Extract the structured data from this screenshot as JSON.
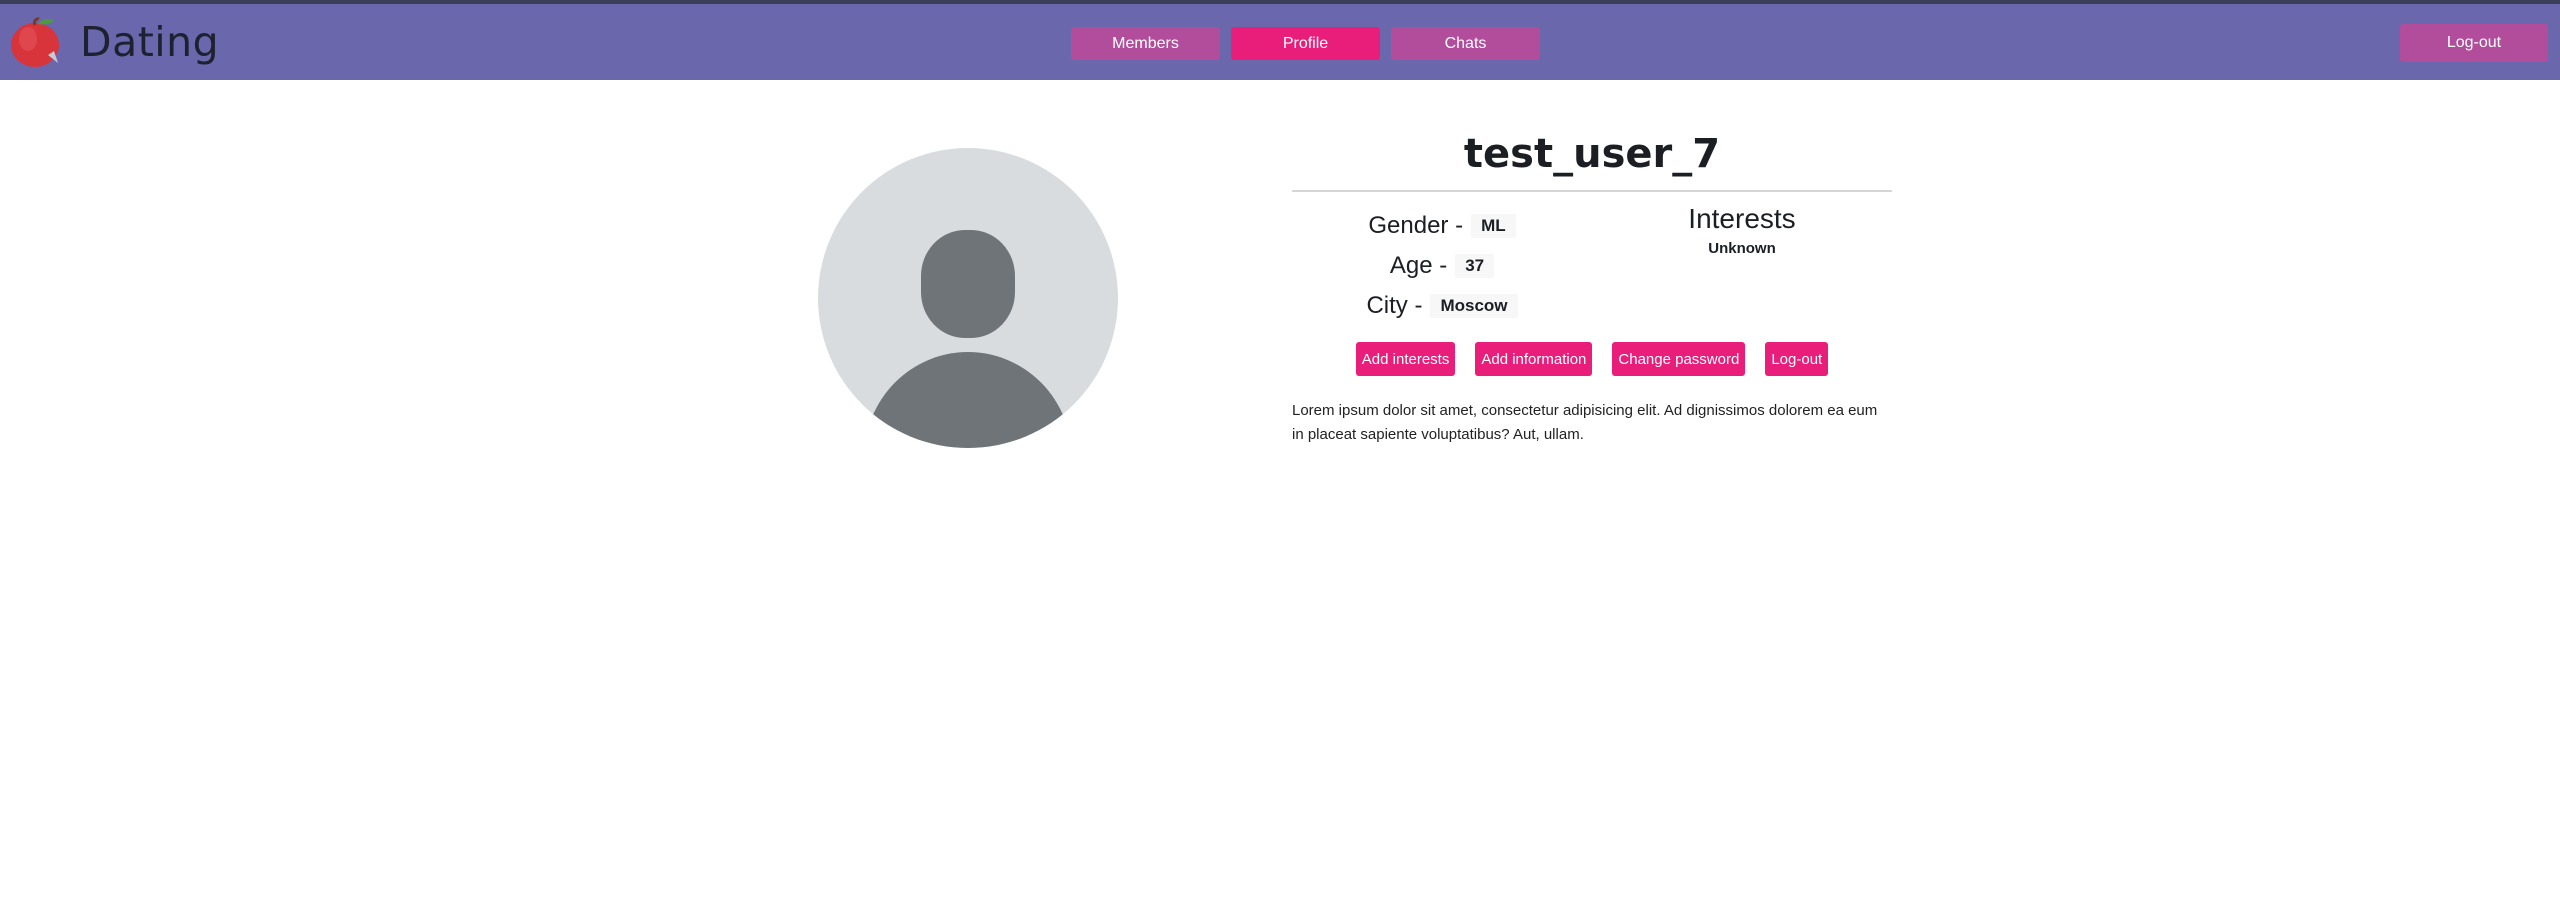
{
  "header": {
    "brand": "Dating",
    "nav": [
      {
        "label": "Members",
        "active": false
      },
      {
        "label": "Profile",
        "active": true
      },
      {
        "label": "Chats",
        "active": false
      }
    ],
    "logout_label": "Log-out"
  },
  "profile": {
    "username": "test_user_7",
    "gender_label": "Gender -",
    "gender_value": "ML",
    "age_label": "Age -",
    "age_value": "37",
    "city_label": "City -",
    "city_value": "Moscow",
    "interests_title": "Interests",
    "interests_value": "Unknown",
    "actions": {
      "add_interests": "Add interests",
      "add_information": "Add information",
      "change_password": "Change password",
      "logout": "Log-out"
    },
    "bio": "Lorem ipsum dolor sit amet, consectetur adipisicing elit. Ad dignissimos dolorem ea eum in placeat sapiente voluptatibus? Aut, ullam."
  },
  "colors": {
    "navbar": "#6a67ad",
    "nav_button": "#b14d9b",
    "accent": "#e91e7a",
    "avatar_bg": "#d9dcdf",
    "avatar_fg": "#6f7479"
  },
  "icons": {
    "logo": "apple-logo-icon",
    "avatar": "user-placeholder-icon"
  }
}
